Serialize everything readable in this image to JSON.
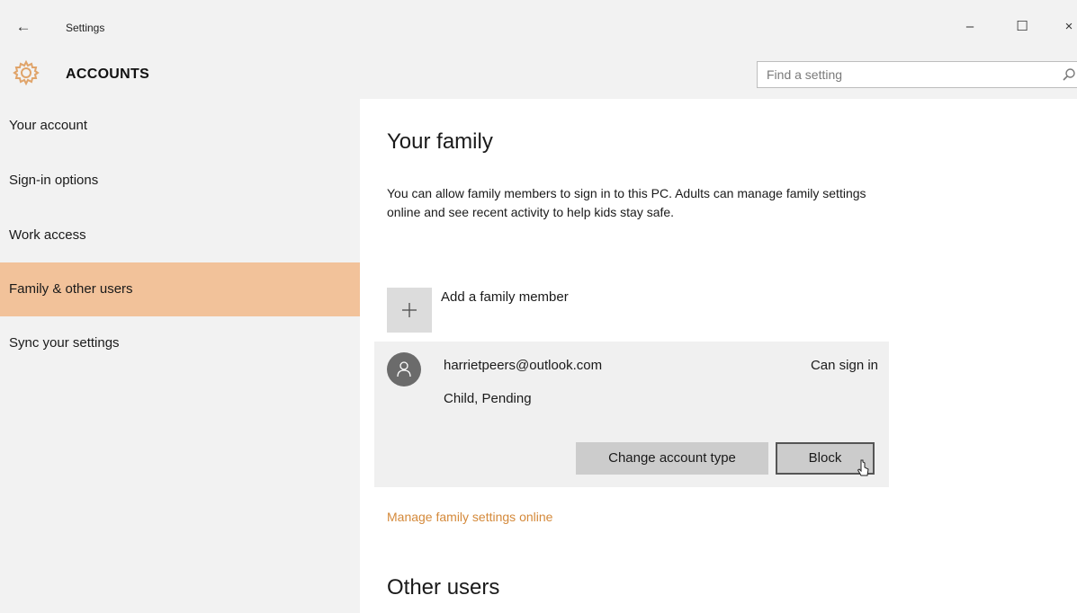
{
  "window": {
    "title": "Settings",
    "back_glyph": "←",
    "minimize_glyph": "–",
    "maximize_glyph": "☐",
    "close_glyph": "×"
  },
  "header": {
    "title": "ACCOUNTS",
    "icon": "gear-icon",
    "search_placeholder": "Find a setting",
    "search_icon": "search-icon"
  },
  "sidebar": {
    "items": [
      {
        "label": "Your account",
        "active": false
      },
      {
        "label": "Sign-in options",
        "active": false
      },
      {
        "label": "Work access",
        "active": false
      },
      {
        "label": "Family & other users",
        "active": true
      },
      {
        "label": "Sync your settings",
        "active": false
      }
    ]
  },
  "main": {
    "family_title": "Your family",
    "description": "You can allow family members to sign in to this PC. Adults can manage family settings online and see recent activity to help kids stay safe.",
    "add_member_label": "Add a family member",
    "member": {
      "email": "harrietpeers@outlook.com",
      "role": "Child, Pending",
      "status": "Can sign in",
      "change_button": "Change account type",
      "block_button": "Block"
    },
    "manage_link": "Manage family settings online",
    "other_title": "Other users"
  },
  "colors": {
    "active_nav": "#f2c29a",
    "accent_link": "#d4893a",
    "gear": "#e0a46a"
  }
}
